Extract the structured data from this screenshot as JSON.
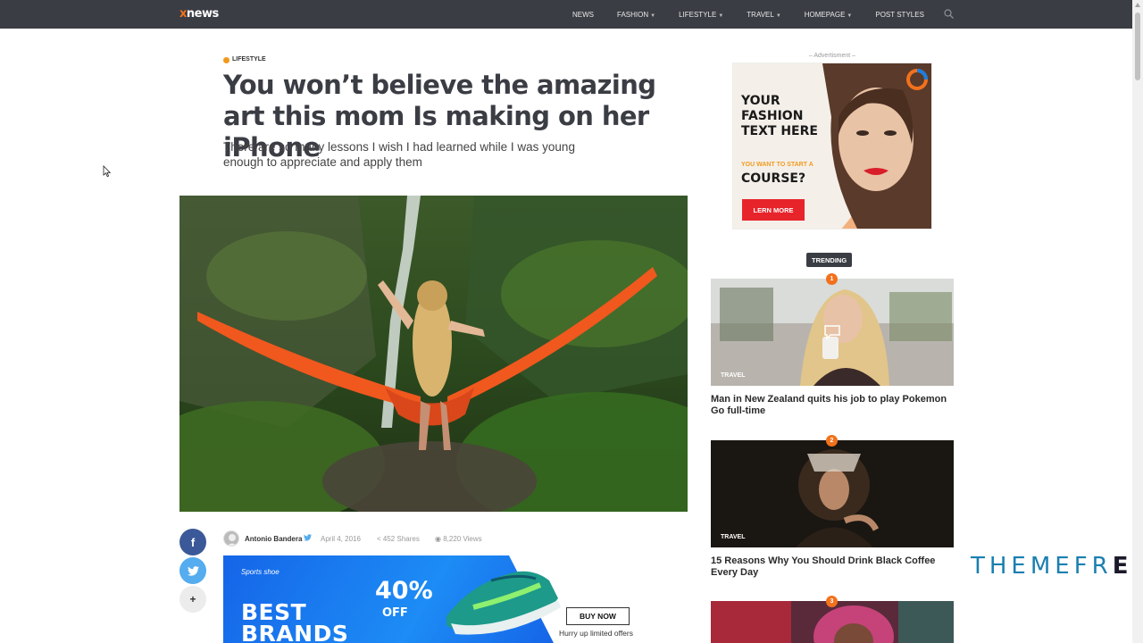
{
  "brand": {
    "logo_x": "x",
    "logo_rest": "news"
  },
  "nav": {
    "items": [
      {
        "label": "NEWS",
        "dropdown": false
      },
      {
        "label": "FASHION",
        "dropdown": true
      },
      {
        "label": "LIFESTYLE",
        "dropdown": true
      },
      {
        "label": "TRAVEL",
        "dropdown": true
      },
      {
        "label": "HOMEPAGE",
        "dropdown": true
      },
      {
        "label": "POST STYLES",
        "dropdown": false
      }
    ],
    "search_icon": "search-icon"
  },
  "article": {
    "category": "LIFESTYLE",
    "category_color": "#f2991c",
    "title": "You won’t believe the amazing art this mom Is making on her iPhone",
    "subtitle": "There are so many lessons I wish I had learned while I was young enough to appreciate and apply them",
    "author": "Antonio Bandera",
    "date": "April 4, 2016",
    "shares": "452 Shares",
    "views": "8,220 Views"
  },
  "share": {
    "facebook": "f",
    "twitter": "t",
    "more": "+"
  },
  "banner_ad": {
    "tagline": "Sports shoe",
    "headline_1": "BEST",
    "headline_2": "BRANDS",
    "percent": "40%",
    "off": "OFF",
    "button": "BUY NOW",
    "note": "Hurry up limited offers"
  },
  "sidebar": {
    "ad_label": "– Advertisment –",
    "ad": {
      "headline": "YOUR FASHION TEXT HERE",
      "small": "YOU WANT TO START A",
      "course": "COURSE?",
      "button": "LERN MORE"
    },
    "trending_label": "TRENDING",
    "trending": [
      {
        "num": "1",
        "tag": "TRAVEL",
        "title": "Man in New Zealand quits his job to play Pokemon Go full-time"
      },
      {
        "num": "2",
        "tag": "TRAVEL",
        "title": "15 Reasons Why You Should Drink Black Coffee Every Day"
      },
      {
        "num": "3",
        "tag": "",
        "title": ""
      }
    ]
  },
  "watermark": {
    "text": "THEMEFR",
    "last": "E"
  },
  "colors": {
    "nav_bg": "#3b3d44",
    "accent": "#f2711c",
    "facebook": "#3b5998",
    "twitter": "#55acee"
  }
}
